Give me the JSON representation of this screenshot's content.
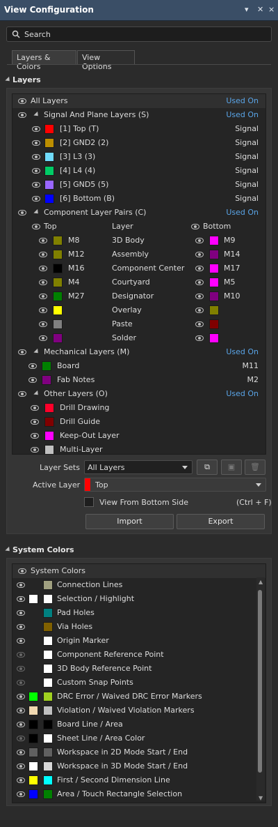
{
  "window": {
    "title": "View Configuration",
    "pin_icon": "pin-icon",
    "close_icon": "close-icon"
  },
  "search": {
    "placeholder": "Search"
  },
  "tabs": [
    {
      "label": "Layers & Colors",
      "active": true
    },
    {
      "label": "View Options",
      "active": false
    }
  ],
  "layers_section": {
    "title": "Layers"
  },
  "all_layers": {
    "label": "All Layers",
    "used_on": "Used On"
  },
  "signal_group": {
    "label": "Signal And Plane Layers (S)",
    "used_on": "Used On",
    "items": [
      {
        "label": "[1] Top (T)",
        "color": "#ff0000",
        "usage": "Signal"
      },
      {
        "label": "[2] GND2 (2)",
        "color": "#bc8e00",
        "usage": "Signal"
      },
      {
        "label": "[3] L3 (3)",
        "color": "#70dbfa",
        "usage": "Signal"
      },
      {
        "label": "[4] L4 (4)",
        "color": "#00cc66",
        "usage": "Signal"
      },
      {
        "label": "[5] GND5 (5)",
        "color": "#9966ff",
        "usage": "Signal"
      },
      {
        "label": "[6] Bottom (B)",
        "color": "#0000ff",
        "usage": "Signal"
      }
    ]
  },
  "component_group": {
    "label": "Component Layer Pairs (C)",
    "used_on": "Used On",
    "col_top": "Top",
    "col_layer": "Layer",
    "col_bottom": "Bottom",
    "items": [
      {
        "top": "M8",
        "top_color": "#808000",
        "layer": "3D Body",
        "bottom": "M9",
        "bottom_color": "#ff00ff"
      },
      {
        "top": "M12",
        "top_color": "#808000",
        "layer": "Assembly",
        "bottom": "M14",
        "bottom_color": "#800080"
      },
      {
        "top": "M16",
        "top_color": "#000000",
        "layer": "Component Center",
        "bottom": "M17",
        "bottom_color": "#ff00ff"
      },
      {
        "top": "M4",
        "top_color": "#808000",
        "layer": "Courtyard",
        "bottom": "M5",
        "bottom_color": "#ff00ff"
      },
      {
        "top": "M27",
        "top_color": "#008000",
        "layer": "Designator",
        "bottom": "M10",
        "bottom_color": "#800080"
      },
      {
        "top": "",
        "top_color": "#ffff00",
        "layer": "Overlay",
        "bottom": "",
        "bottom_color": "#808000"
      },
      {
        "top": "",
        "top_color": "#808080",
        "layer": "Paste",
        "bottom": "",
        "bottom_color": "#800000"
      },
      {
        "top": "",
        "top_color": "#800080",
        "layer": "Solder",
        "bottom": "",
        "bottom_color": "#ff00ff"
      }
    ]
  },
  "mechanical_group": {
    "label": "Mechanical Layers (M)",
    "used_on": "Used On",
    "items": [
      {
        "label": "Board",
        "color": "#008000",
        "usage": "M11"
      },
      {
        "label": "Fab Notes",
        "color": "#800080",
        "usage": "M2"
      }
    ]
  },
  "other_group": {
    "label": "Other Layers (O)",
    "used_on": "Used On",
    "items": [
      {
        "label": "Drill Drawing",
        "color": "#ff002a"
      },
      {
        "label": "Drill Guide",
        "color": "#800000"
      },
      {
        "label": "Keep-Out Layer",
        "color": "#ff00ff"
      },
      {
        "label": "Multi-Layer",
        "color": "#c0c0c0"
      }
    ]
  },
  "layer_sets": {
    "label": "Layer Sets",
    "value": "All Layers"
  },
  "active_layer": {
    "label": "Active Layer",
    "value": "Top",
    "color": "#ff0000"
  },
  "view_from_bottom": {
    "label": "View From Bottom Side",
    "shortcut": "(Ctrl + F)",
    "checked": false
  },
  "buttons": {
    "import": "Import",
    "export": "Export"
  },
  "system_section": {
    "title": "System Colors",
    "header": "System Colors"
  },
  "system_colors": [
    {
      "label": "Connection Lines",
      "visible": true,
      "c1": null,
      "c2": "#a0a080"
    },
    {
      "label": "Selection / Highlight",
      "visible": true,
      "c1": "#ffffff",
      "c2": "#ffffff"
    },
    {
      "label": "Pad Holes",
      "visible": true,
      "c1": null,
      "c2": "#008080"
    },
    {
      "label": "Via Holes",
      "visible": true,
      "c1": null,
      "c2": "#806000"
    },
    {
      "label": "Origin Marker",
      "visible": true,
      "c1": null,
      "c2": "#ffffff"
    },
    {
      "label": "Component Reference Point",
      "visible": false,
      "c1": null,
      "c2": "#ffffff"
    },
    {
      "label": "3D Body Reference Point",
      "visible": false,
      "c1": null,
      "c2": "#ffffff"
    },
    {
      "label": "Custom Snap Points",
      "visible": false,
      "c1": null,
      "c2": "#ffffff"
    },
    {
      "label": "DRC Error / Waived DRC Error Markers",
      "visible": true,
      "c1": "#00ff00",
      "c2": "#a0d020"
    },
    {
      "label": "Violation / Waived Violation Markers",
      "visible": true,
      "c1": "#f0d8b0",
      "c2": "#c0c0c0"
    },
    {
      "label": "Board Line / Area",
      "visible": true,
      "c1": "#000000",
      "c2": "#000000"
    },
    {
      "label": "Sheet Line / Area Color",
      "visible": false,
      "c1": "#000000",
      "c2": "#ffffff"
    },
    {
      "label": "Workspace in 2D Mode Start / End",
      "visible": true,
      "c1": "#606060",
      "c2": "#606060"
    },
    {
      "label": "Workspace in 3D Mode Start / End",
      "visible": true,
      "c1": "#ffffff",
      "c2": "#d8d8d8"
    },
    {
      "label": "First / Second Dimension Line",
      "visible": true,
      "c1": "#ffff00",
      "c2": "#00ffff"
    },
    {
      "label": "Area / Touch Rectangle Selection",
      "visible": true,
      "c1": "#0000ff",
      "c2": "#008000"
    }
  ]
}
